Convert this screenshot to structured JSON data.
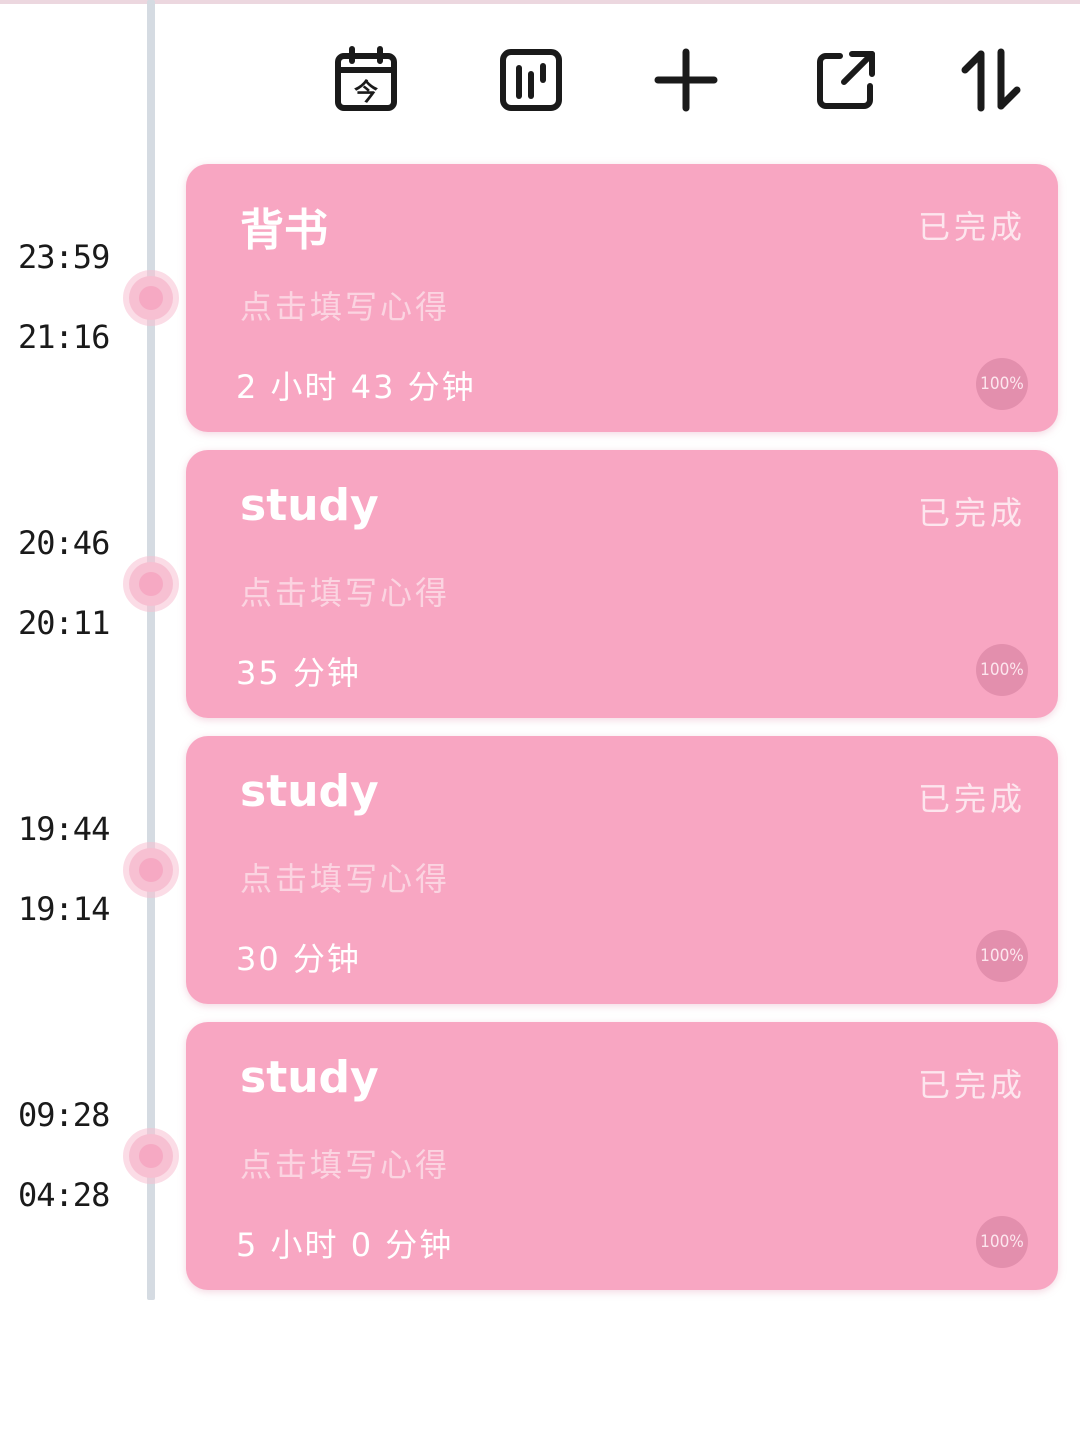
{
  "toolbar": {
    "buttons": [
      {
        "name": "calendar-today-icon",
        "glyph": "今"
      },
      {
        "name": "statistics-icon"
      },
      {
        "name": "add-icon"
      },
      {
        "name": "share-icon"
      },
      {
        "name": "sort-icon"
      }
    ]
  },
  "entries": [
    {
      "title": "背书",
      "status": "已完成",
      "note_placeholder": "点击填写心得",
      "duration": "2 小时 43 分钟",
      "progress": "100%",
      "end_time": "23:59",
      "start_time": "21:16"
    },
    {
      "title": "study",
      "status": "已完成",
      "note_placeholder": "点击填写心得",
      "duration": "35 分钟",
      "progress": "100%",
      "end_time": "20:46",
      "start_time": "20:11"
    },
    {
      "title": "study",
      "status": "已完成",
      "note_placeholder": "点击填写心得",
      "duration": "30 分钟",
      "progress": "100%",
      "end_time": "19:44",
      "start_time": "19:14"
    },
    {
      "title": "study",
      "status": "已完成",
      "note_placeholder": "点击填写心得",
      "duration": "5 小时 0 分钟",
      "progress": "100%",
      "end_time": "09:28",
      "start_time": "04:28"
    }
  ],
  "colors": {
    "card": "#f8a6c2",
    "timeline": "#d5dbe2",
    "dot": "#f6a9c3"
  }
}
